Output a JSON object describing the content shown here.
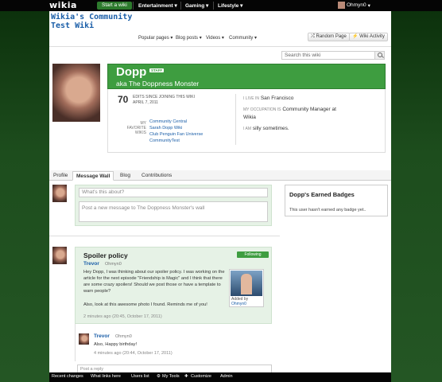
{
  "global_nav": {
    "logo": "wikia",
    "start_wiki": "Start a wiki",
    "items": [
      "Entertainment",
      "Gaming",
      "Lifestyle"
    ],
    "user": "Ohmyn0"
  },
  "wiki": {
    "title": "Wikia's Community Test Wiki",
    "nav": [
      "Popular pages",
      "Blog posts",
      "Videos",
      "Community"
    ],
    "random_page": "Random Page",
    "wiki_activity": "Wiki Activity",
    "search_placeholder": "Search this wiki"
  },
  "profile": {
    "name": "Dopp",
    "badge": "STAFF",
    "aka": "aka The Doppness Monster",
    "edits": "70",
    "edits_label_1": "EDITS SINCE JOINING THIS WIKI",
    "edits_label_2": "APRIL 7, 2011",
    "fav_label_1": "MY",
    "fav_label_2": "FAVORITE",
    "fav_label_3": "WIKIS",
    "favorite_wikis": [
      "Community Central",
      "Sarah Dopp Wiki",
      "Club Penguin Fan Universe",
      "CommunityTest"
    ],
    "live_label": "I LIVE IN",
    "live_value": "San Francisco",
    "occupation_label": "MY OCCUPATION IS",
    "occupation_value": "Community Manager at",
    "occupation_value_2": "Wikia",
    "am_label": "I AM",
    "am_value": "silly sometimes."
  },
  "tabs": [
    "Profile",
    "Message Wall",
    "Blog",
    "Contributions"
  ],
  "badges": {
    "title": "Dopp's Earned Badges",
    "empty": "This user hasn't earned any badge yet.."
  },
  "wall": {
    "subject_placeholder": "What's this about?",
    "body_placeholder": "Post a new message to The Doppness Monster's wall"
  },
  "thread": {
    "title": "Spoiler policy",
    "follow": "Following",
    "author": "Trevor",
    "author_user": "Ohmyn0",
    "msg_1": "Hey Dopp, I was thinking about our spoiler policy. I was working on the article for the next episode \"Friendship is Magic\" and I think that there are some crazy spoilers! Should we post those or have a template to warn people?",
    "msg_2": "Also, look at this awesome photo I found. Reminds me of you!",
    "time": "2 minutes ago (20:45, October 17, 2011)",
    "image_caption": "Added by",
    "image_user": "Ohmyn0"
  },
  "reply": {
    "author": "Trevor",
    "author_user": "Ohmyn0",
    "msg": "Also, Happy birthday!",
    "time": "4 minutes ago (20:44, October 17, 2011)",
    "post_placeholder": "Post a reply"
  },
  "toolbar": [
    "Recent changes",
    "What links here",
    "Users list",
    "My Tools",
    "Customize",
    "Admin"
  ]
}
